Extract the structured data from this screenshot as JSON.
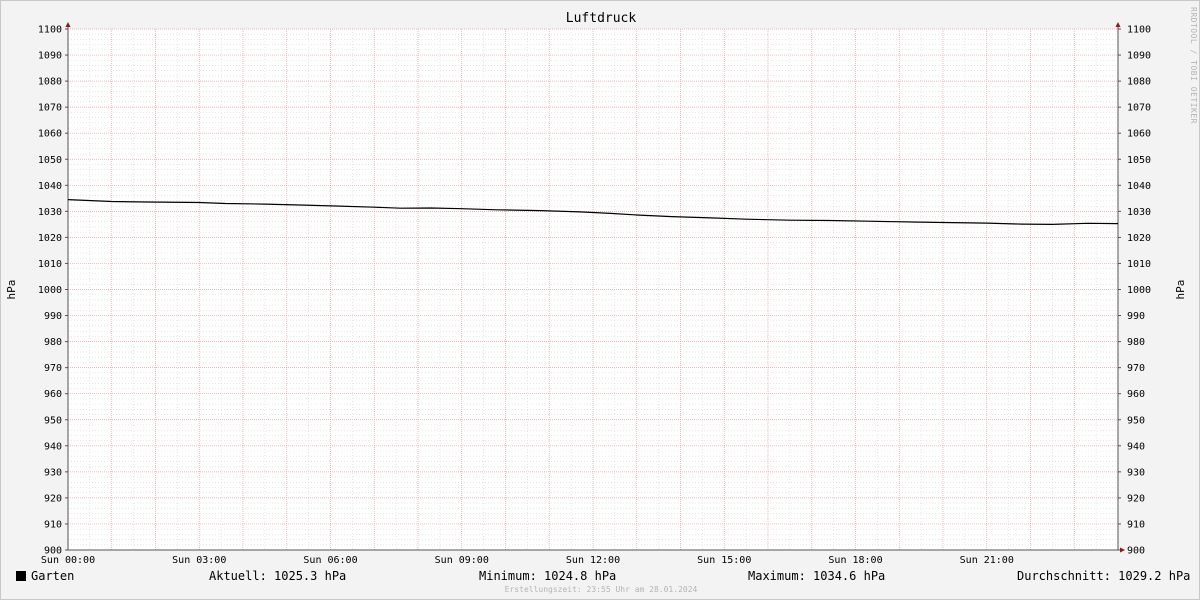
{
  "chart_data": {
    "type": "line",
    "title": "Luftdruck",
    "ylabel": "hPa",
    "ylabel_right": "hPa",
    "xlabel": "",
    "ylim": [
      900,
      1100
    ],
    "xlim": [
      "Sun 00:00",
      "Sun 24:00"
    ],
    "y_ticks": [
      900,
      910,
      920,
      930,
      940,
      950,
      960,
      970,
      980,
      990,
      1000,
      1010,
      1020,
      1030,
      1040,
      1050,
      1060,
      1070,
      1080,
      1090,
      1100
    ],
    "x_tick_labels": [
      "Sun 00:00",
      "Sun 03:00",
      "Sun 06:00",
      "Sun 09:00",
      "Sun 12:00",
      "Sun 15:00",
      "Sun 18:00",
      "Sun 21:00"
    ],
    "x_tick_hours": [
      0,
      3,
      6,
      9,
      12,
      15,
      18,
      21
    ],
    "grid": true,
    "series": [
      {
        "name": "Garten",
        "color": "#000000",
        "x_hours": [
          0,
          0.4,
          1,
          1.8,
          3,
          3.6,
          4.5,
          5.4,
          6.2,
          7.0,
          7.6,
          8.3,
          9.0,
          9.8,
          10.8,
          11.7,
          12.4,
          13.0,
          13.8,
          14.7,
          15.5,
          16.5,
          17.4,
          18.3,
          19.3,
          20.2,
          21.0,
          21.8,
          22.5,
          23.3,
          24.0
        ],
        "values": [
          1034.5,
          1034.2,
          1033.8,
          1033.6,
          1033.4,
          1033.0,
          1032.8,
          1032.4,
          1032.0,
          1031.6,
          1031.2,
          1031.3,
          1031.0,
          1030.6,
          1030.3,
          1029.8,
          1029.2,
          1028.6,
          1028.0,
          1027.5,
          1027.0,
          1026.6,
          1026.5,
          1026.2,
          1025.9,
          1025.7,
          1025.5,
          1025.1,
          1025.0,
          1025.4,
          1025.3
        ]
      }
    ]
  },
  "watermark": "RRDTOOL / TOBI OETIKER",
  "legend": {
    "series_name": "Garten",
    "swatch_color": "#000000",
    "aktuell": "Aktuell: 1025.3 hPa",
    "minimum": "Minimum: 1024.8 hPa",
    "maximum": "Maximum: 1034.6 hPa",
    "durchschnitt": "Durchschnitt: 1029.2 hPa"
  },
  "footer": "Erstellungszeit: 23:55 Uhr am 28.01.2024",
  "colors": {
    "background": "#f3f3f3",
    "plot_background": "#ffffff",
    "minor_grid": "#d8d8d8",
    "major_grid": "#e8a0a0",
    "axis_arrow": "#8b1a1a"
  }
}
